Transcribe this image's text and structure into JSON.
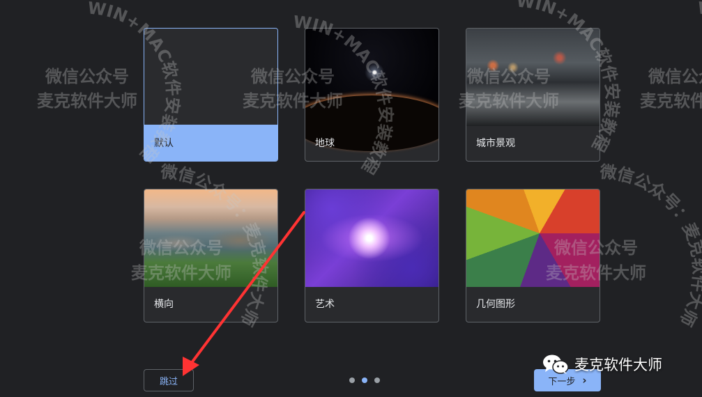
{
  "themes": [
    {
      "label": "默认",
      "selected": true
    },
    {
      "label": "地球",
      "selected": false
    },
    {
      "label": "城市景观",
      "selected": false
    },
    {
      "label": "横向",
      "selected": false
    },
    {
      "label": "艺术",
      "selected": false
    },
    {
      "label": "几何图形",
      "selected": false
    }
  ],
  "pagination": {
    "total": 3,
    "current": 2
  },
  "buttons": {
    "skip": "跳过",
    "next": "下一步"
  },
  "watermark": {
    "ring_text": "WIN+MAC软件安装教程",
    "line1": "微信公众号",
    "line2": "麦克软件大师",
    "arc_text": "微信公众号：麦克软件大师"
  },
  "brand": {
    "name": "麦克软件大师",
    "icon": "wechat-icon"
  },
  "colors": {
    "accent": "#8ab4f8",
    "background": "#202124",
    "annotation": "#ff3333"
  }
}
